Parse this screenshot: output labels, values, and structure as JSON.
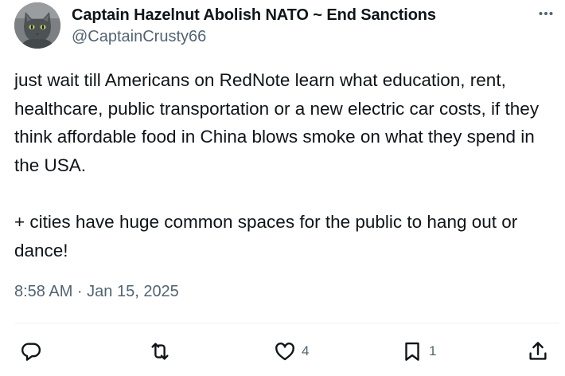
{
  "author": {
    "display_name": "Captain Hazelnut Abolish NATO ~ End Sanctions",
    "handle": "@CaptainCrusty66"
  },
  "tweet": {
    "paragraphs": [
      "just wait till Americans on RedNote learn what education, rent, healthcare, public transportation or a new electric car costs, if they think affordable food in China blows smoke on what they spend in the USA.",
      "+ cities have huge common spaces for the public to hang out or dance!"
    ],
    "timestamp": "8:58 AM · Jan 15, 2025"
  },
  "actions": {
    "reply": {
      "icon": "reply-icon",
      "count": ""
    },
    "repost": {
      "icon": "repost-icon",
      "count": ""
    },
    "like": {
      "icon": "heart-icon",
      "count": "4"
    },
    "bookmark": {
      "icon": "bookmark-icon",
      "count": "1"
    },
    "share": {
      "icon": "share-icon",
      "count": ""
    }
  },
  "colors": {
    "text_primary": "#0f1419",
    "text_secondary": "#536471",
    "divider": "#eff3f4",
    "background": "#ffffff"
  }
}
